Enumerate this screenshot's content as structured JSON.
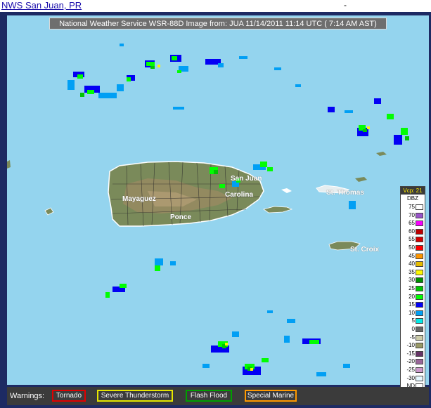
{
  "header": {
    "site_title": "NWS San Juan, PR",
    "right_mark": "-"
  },
  "radar": {
    "title": "National Weather Service WSR-88D Image  from:  JUA 11/14/2011 11:14 UTC ( 7:14 AM AST)"
  },
  "places": {
    "san_juan": "San Juan",
    "carolina": "Carolina",
    "mayaguez": "Mayaguez",
    "ponce": "Ponce",
    "st_thomas": "St. Thomas",
    "st_croix": "St. Croix"
  },
  "legend": {
    "vcp": "Vcp: 21",
    "unit": "DBZ",
    "entries": [
      {
        "label": "75",
        "color": "#ffffff"
      },
      {
        "label": "70",
        "color": "#9954c9"
      },
      {
        "label": "65",
        "color": "#f800fd"
      },
      {
        "label": "60",
        "color": "#bc0000"
      },
      {
        "label": "55",
        "color": "#d40000"
      },
      {
        "label": "50",
        "color": "#fd0000"
      },
      {
        "label": "45",
        "color": "#fd9500"
      },
      {
        "label": "40",
        "color": "#e5bc00"
      },
      {
        "label": "35",
        "color": "#fdf802"
      },
      {
        "label": "30",
        "color": "#008e00"
      },
      {
        "label": "25",
        "color": "#01c501"
      },
      {
        "label": "20",
        "color": "#02fd02"
      },
      {
        "label": "15",
        "color": "#0300f4"
      },
      {
        "label": "10",
        "color": "#019ff4"
      },
      {
        "label": "5",
        "color": "#04e9e7"
      },
      {
        "label": "0",
        "color": "#666666"
      },
      {
        "label": "-5",
        "color": "#ccccaa"
      },
      {
        "label": "-10",
        "color": "#999966"
      },
      {
        "label": "-15",
        "color": "#663366"
      },
      {
        "label": "-20",
        "color": "#996699"
      },
      {
        "label": "-25",
        "color": "#cc99cc"
      },
      {
        "label": "-30",
        "color": "#e6f8ff"
      },
      {
        "label": "ND",
        "color": "#ffffff"
      }
    ]
  },
  "warnings": {
    "label": "Warnings:",
    "items": [
      {
        "label": "Tornado",
        "color": "#e00000"
      },
      {
        "label": "Severe Thunderstorm",
        "color": "#e6e600"
      },
      {
        "label": "Flash Flood",
        "color": "#00a000"
      },
      {
        "label": "Special Marine",
        "color": "#ff9900"
      }
    ]
  }
}
